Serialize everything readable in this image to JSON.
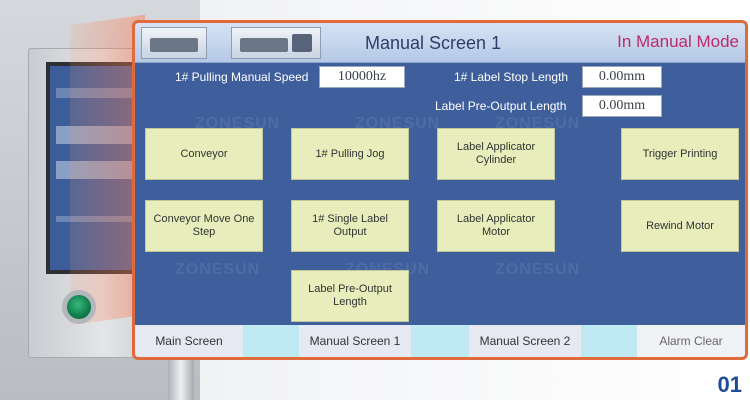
{
  "header": {
    "title": "Manual Screen 1",
    "mode": "In Manual Mode"
  },
  "fields": {
    "pulling_speed_label": "1# Pulling Manual Speed",
    "pulling_speed_value": "10000hz",
    "label_stop_length_label": "1# Label Stop Length",
    "label_stop_length_value": "0.00mm",
    "label_pre_output_length_label": "Label Pre-Output Length",
    "label_pre_output_length_value": "0.00mm"
  },
  "buttons": [
    {
      "label": "Conveyor"
    },
    {
      "label": "1# Pulling Jog"
    },
    {
      "label": "Label Applicator Cylinder"
    },
    {
      "label": "Trigger Printing"
    },
    {
      "label": "Conveyor Move One Step"
    },
    {
      "label": "1# Single Label Output"
    },
    {
      "label": "Label Applicator Motor"
    },
    {
      "label": "Rewind Motor"
    },
    {
      "label": "Label Pre-Output Length"
    }
  ],
  "footer": {
    "tabs": [
      "Main Screen",
      "Manual Screen 1",
      "Manual Screen 2",
      "Alarm Clear"
    ]
  },
  "watermark": "ZONESUN",
  "page_number": "01",
  "colors": {
    "panel_bg": "#3f5f9c",
    "button_bg": "#e7edbb",
    "accent_border": "#e06a3b",
    "mode_text": "#c0296b"
  }
}
